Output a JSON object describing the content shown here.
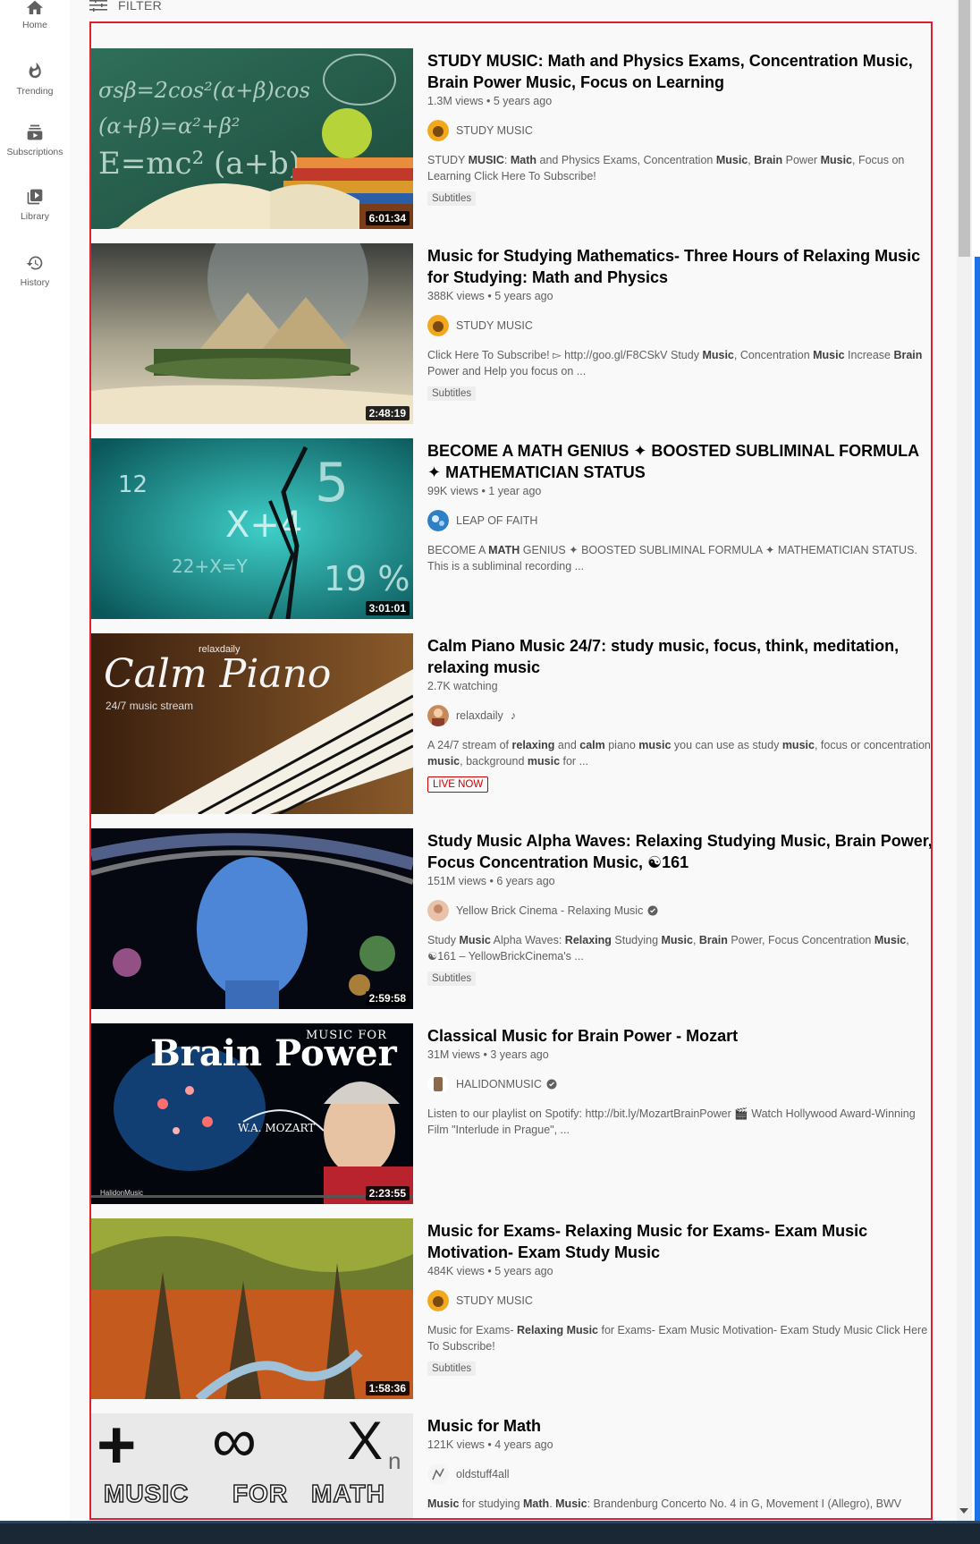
{
  "sidebar": {
    "items": [
      {
        "label": "Home",
        "icon": "home-icon"
      },
      {
        "label": "Trending",
        "icon": "flame-icon"
      },
      {
        "label": "Subscriptions",
        "icon": "subscriptions-icon"
      },
      {
        "label": "Library",
        "icon": "library-icon"
      },
      {
        "label": "History",
        "icon": "history-icon"
      }
    ]
  },
  "filter": {
    "label": "FILTER",
    "icon": "filter-icon"
  },
  "results": [
    {
      "title": "STUDY MUSIC: Math and Physics Exams, Concentration Music, Brain Power Music, Focus on Learning",
      "meta": "1.3M views • 5 years ago",
      "channel": "STUDY MUSIC",
      "verified": false,
      "desc_html": "STUDY <b>MUSIC</b>: <b>Math</b> and Physics Exams, Concentration <b>Music</b>, <b>Brain</b> Power <b>Music</b>, Focus on Learning Click Here To Subscribe!",
      "badge": "Subtitles",
      "badge_type": "normal",
      "duration": "6:01:34"
    },
    {
      "title": "Music for Studying Mathematics- Three Hours of Relaxing Music for Studying: Math and Physics",
      "meta": "388K views • 5 years ago",
      "channel": "STUDY MUSIC",
      "verified": false,
      "desc_html": "Click Here To Subscribe! ▻ http://goo.gl/F8CSkV Study <b>Music</b>, Concentration <b>Music</b> Increase <b>Brain</b> Power and Help you focus on ...",
      "badge": "Subtitles",
      "badge_type": "normal",
      "duration": "2:48:19"
    },
    {
      "title": "BECOME A MATH GENIUS ✦ BOOSTED SUBLIMINAL FORMULA ✦ MATHEMATICIAN STATUS",
      "meta": "99K views • 1 year ago",
      "channel": "LEAP OF FAITH",
      "verified": false,
      "desc_html": "BECOME A <b>MATH</b> GENIUS ✦ BOOSTED SUBLIMINAL FORMULA ✦ MATHEMATICIAN STATUS. This is a subliminal recording ...",
      "badge": "",
      "badge_type": "none",
      "duration": "3:01:01"
    },
    {
      "title": "Calm Piano Music 24/7: study music, focus, think, meditation, relaxing music",
      "meta": "2.7K watching",
      "channel": "relaxdaily",
      "verified": false,
      "music_note": "♪",
      "desc_html": "A 24/7 stream of <b>relaxing</b> and <b>calm</b> piano <b>music</b> you can use as study <b>music</b>, focus or concentration <b>music</b>, background <b>music</b> for ...",
      "badge": "LIVE NOW",
      "badge_type": "live",
      "duration": "",
      "thumb_text": {
        "channel": "relaxdaily",
        "title": "Calm Piano",
        "sub": "24/7 music stream"
      }
    },
    {
      "title": "Study Music Alpha Waves: Relaxing Studying Music, Brain Power, Focus Concentration Music, ☯161",
      "meta": "151M views • 6 years ago",
      "channel": "Yellow Brick Cinema - Relaxing Music",
      "verified": true,
      "desc_html": "Study <b>Music</b> Alpha Waves: <b>Relaxing</b> Studying <b>Music</b>, <b>Brain</b> Power, Focus Concentration <b>Music</b>, ☯161 – YellowBrickCinema's ...",
      "badge": "Subtitles",
      "badge_type": "normal",
      "duration": "2:59:58"
    },
    {
      "title": "Classical Music for Brain Power - Mozart",
      "meta": "31M views • 3 years ago",
      "channel": "HALIDONMUSIC",
      "verified": true,
      "desc_html": "Listen to our playlist on Spotify: http://bit.ly/MozartBrainPower 🎬 Watch Hollywood Award-Winning Film \"Interlude in Prague\", ...",
      "badge": "",
      "badge_type": "none",
      "duration": "2:23:55",
      "thumb_text": {
        "top": "MUSIC FOR",
        "title": "Brain Power",
        "sub": "W.A. MOZART",
        "brand": "HalidonMusic"
      }
    },
    {
      "title": "Music for Exams- Relaxing Music for Exams- Exam Music Motivation- Exam Study Music",
      "meta": "484K views • 5 years ago",
      "channel": "STUDY MUSIC",
      "verified": false,
      "desc_html": "Music for Exams- <b>Relaxing Music</b> for Exams- Exam Music Motivation- Exam Study Music Click Here To Subscribe!",
      "badge": "Subtitles",
      "badge_type": "normal",
      "duration": "1:58:36"
    },
    {
      "title": "Music for Math",
      "meta": "121K views • 4 years ago",
      "channel": "oldstuff4all",
      "verified": false,
      "desc_html": "<b>Music</b> for studying <b>Math</b>. <b>Music</b>: Brandenburg Concerto No. 4 in G, Movement I (Allegro), BWV",
      "badge": "",
      "badge_type": "none",
      "duration": "",
      "thumb_text": {
        "plus": "+",
        "inf": "∞",
        "x": "X",
        "n": "n",
        "w1": "MUSIC",
        "w2": "FOR",
        "w3": "MATH"
      }
    }
  ]
}
